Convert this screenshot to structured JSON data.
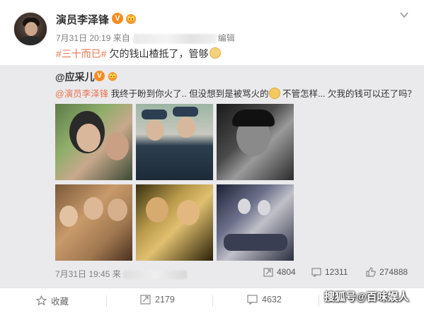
{
  "post": {
    "author": "演员李泽锋",
    "verified_badge": "V",
    "date": "7月31日 20:19",
    "source_prefix": "来自",
    "edited_label": "编辑",
    "hashtag": "#三十而已#",
    "text": " 欠的钱山楂抵了，管够"
  },
  "repost": {
    "author": "@应采儿",
    "verified_badge": "V",
    "mention": "@演员李泽锋",
    "text_part1": " 我终于盼到你火了.. 但没想到是被骂火的",
    "text_part2": " 不管怎样... 欠我的钱可以还了吗？",
    "date": "7月31日 19:45",
    "source_prefix": "来",
    "stats": {
      "reposts": "4804",
      "comments": "12311",
      "likes": "274888"
    }
  },
  "footer": {
    "favorite_label": "收藏",
    "repost_count": "2179",
    "comment_count": "4632"
  },
  "watermark": "搜狐号@百味娱人",
  "colors": {
    "accent_orange": "#eb7350",
    "badge_orange": "#f78b1f",
    "repost_bg": "#eaeaec"
  }
}
